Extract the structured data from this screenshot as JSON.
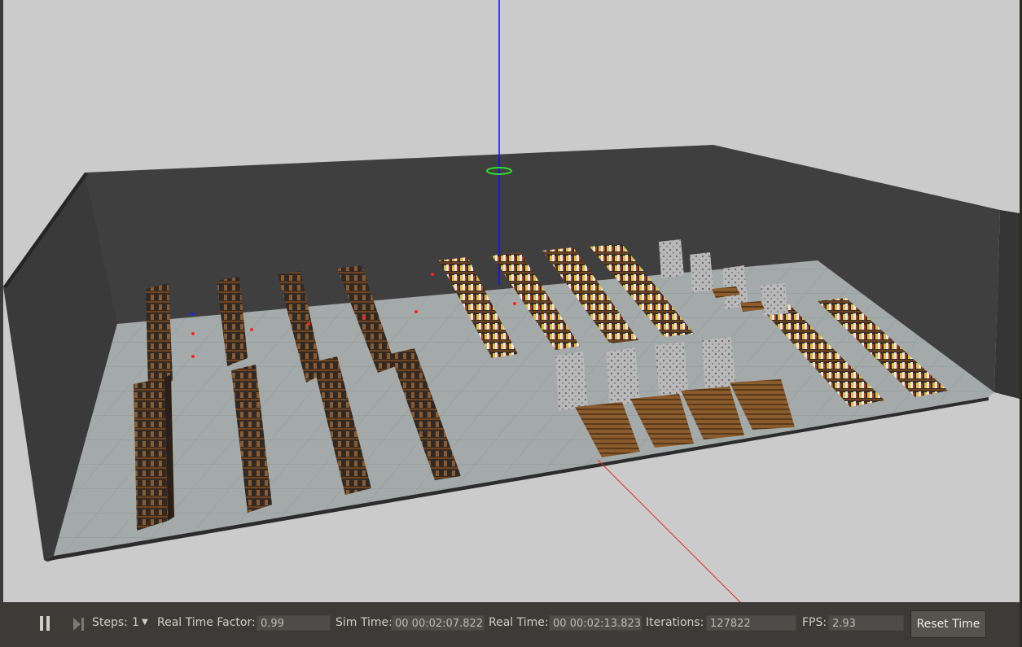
{
  "toolbar": {
    "pause_icon": "pause-icon",
    "step_icon": "step-forward-icon",
    "steps_label": "Steps:",
    "steps_value": "1",
    "real_time_factor_label": "Real Time Factor:",
    "real_time_factor_value": "0.99",
    "sim_time_label": "Sim Time:",
    "sim_time_value": "00 00:02:07.822",
    "real_time_label": "Real Time:",
    "real_time_value": "00 00:02:13.823",
    "iterations_label": "Iterations:",
    "iterations_value": "127822",
    "fps_label": "FPS:",
    "fps_value": "2.93",
    "reset_time_label": "Reset Time"
  },
  "scene": {
    "background_color": "#cbcbcb",
    "wall_color": "#3d3d3d",
    "floor_color": "#a5abaa",
    "z_axis_color": "#1010ff",
    "x_axis_color": "#e03030",
    "marker_color": "#30e030"
  }
}
